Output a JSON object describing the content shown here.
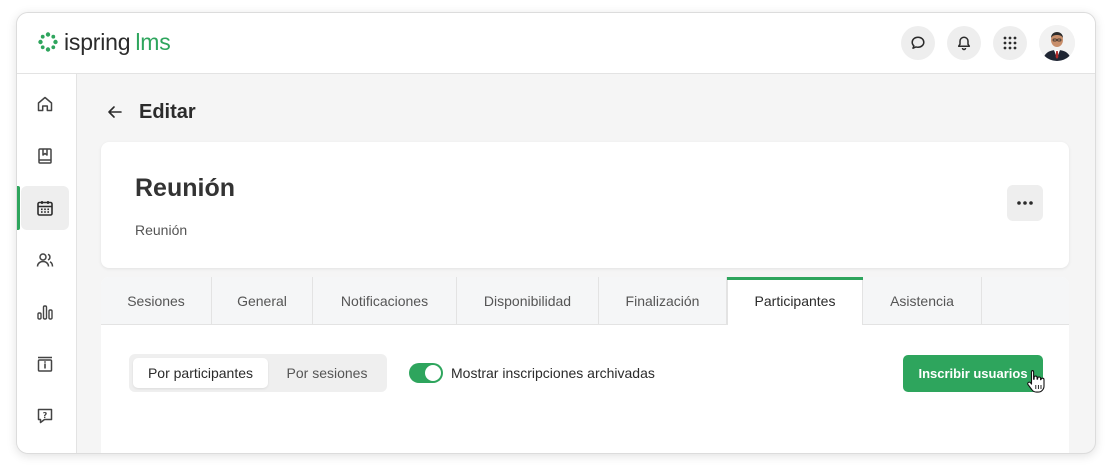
{
  "brand": {
    "name": "ispring",
    "product": "lms",
    "accent": "#2ea55d"
  },
  "topbar": {
    "icons": [
      "chat-icon",
      "bell-icon",
      "apps-grid-icon",
      "user-avatar"
    ]
  },
  "sidebar": {
    "items": [
      {
        "icon": "home-icon",
        "active": false
      },
      {
        "icon": "book-icon",
        "active": false
      },
      {
        "icon": "calendar-icon",
        "active": true
      },
      {
        "icon": "users-icon",
        "active": false
      },
      {
        "icon": "bar-chart-icon",
        "active": false
      },
      {
        "icon": "info-box-icon",
        "active": false
      },
      {
        "icon": "help-chat-icon",
        "active": false
      }
    ]
  },
  "page": {
    "title": "Editar"
  },
  "event_card": {
    "title": "Reunión",
    "subtitle": "Reunión"
  },
  "tabs": [
    {
      "label": "Sesiones",
      "active": false
    },
    {
      "label": "General",
      "active": false
    },
    {
      "label": "Notificaciones",
      "active": false
    },
    {
      "label": "Disponibilidad",
      "active": false
    },
    {
      "label": "Finalización",
      "active": false
    },
    {
      "label": "Participantes",
      "active": true
    },
    {
      "label": "Asistencia",
      "active": false
    }
  ],
  "participants": {
    "segment": {
      "options": [
        "Por participantes",
        "Por sesiones"
      ],
      "selected": "Por participantes"
    },
    "toggle": {
      "label": "Mostrar inscripciones archivadas",
      "on": true
    },
    "enroll_button": "Inscribir usuarios"
  }
}
